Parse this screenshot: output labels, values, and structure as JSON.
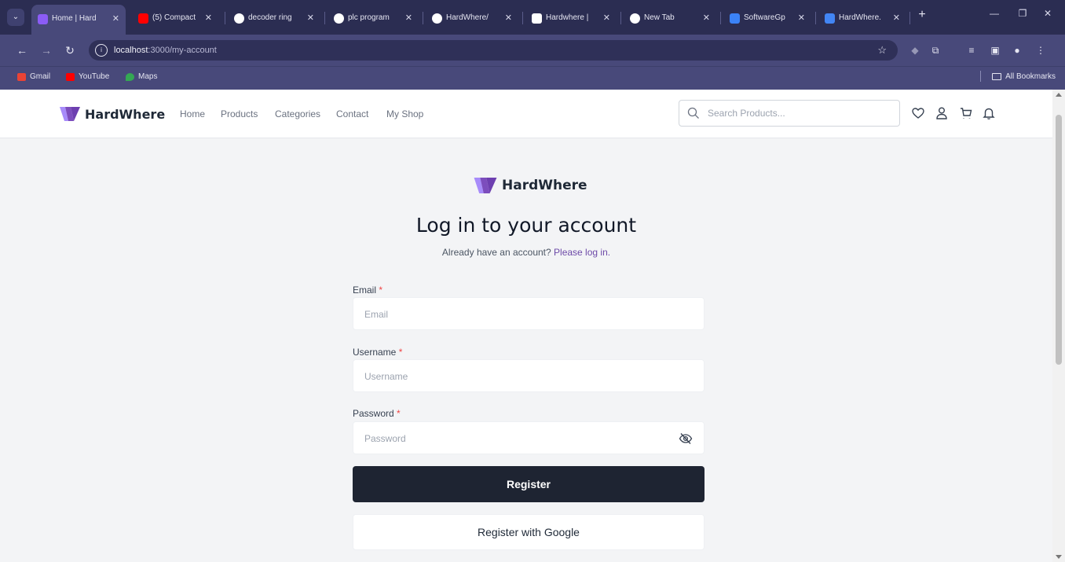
{
  "browser": {
    "tabs": [
      {
        "title": "Home | Hard",
        "active": true,
        "favicon_color": "#8b5cf6"
      },
      {
        "title": "(5) Compact",
        "active": false,
        "favicon_color": "#ff0000"
      },
      {
        "title": "decoder ring",
        "active": false,
        "favicon_color": "#ffffff"
      },
      {
        "title": "plc program",
        "active": false,
        "favicon_color": "#ffffff"
      },
      {
        "title": "HardWhere/",
        "active": false,
        "favicon_color": "#ffffff"
      },
      {
        "title": "Hardwhere |",
        "active": false,
        "favicon_color": "#ffffff"
      },
      {
        "title": "New Tab",
        "active": false,
        "favicon_color": "#ffffff"
      },
      {
        "title": "SoftwareGp",
        "active": false,
        "favicon_color": "#3b82f6"
      },
      {
        "title": "HardWhere.",
        "active": false,
        "favicon_color": "#4285f4"
      }
    ],
    "url_host": "localhost",
    "url_path": ":3000/my-account",
    "bookmarks": [
      {
        "label": "Gmail",
        "color": "#ea4335"
      },
      {
        "label": "YouTube",
        "color": "#ff0000"
      },
      {
        "label": "Maps",
        "color": "#34a853"
      }
    ],
    "all_bookmarks": "All Bookmarks"
  },
  "header": {
    "brand": "HardWhere",
    "nav": [
      "Home",
      "Products",
      "Categories",
      "Contact",
      "My Shop"
    ],
    "search_placeholder": "Search Products..."
  },
  "form": {
    "brand": "HardWhere",
    "title": "Log in to your account",
    "subtitle_text": "Already have an account?",
    "subtitle_link": "Please log in.",
    "fields": [
      {
        "label": "Email",
        "placeholder": "Email"
      },
      {
        "label": "Username",
        "placeholder": "Username"
      },
      {
        "label": "Password",
        "placeholder": "Password"
      }
    ],
    "required_mark": "*",
    "register_label": "Register",
    "google_label": "Register with Google"
  },
  "colors": {
    "brand_purple": "#7c4dbd",
    "brand_light": "#a78bfa",
    "button_dark": "#1e2432",
    "link": "#6d4aa8",
    "required": "#ef4444"
  }
}
